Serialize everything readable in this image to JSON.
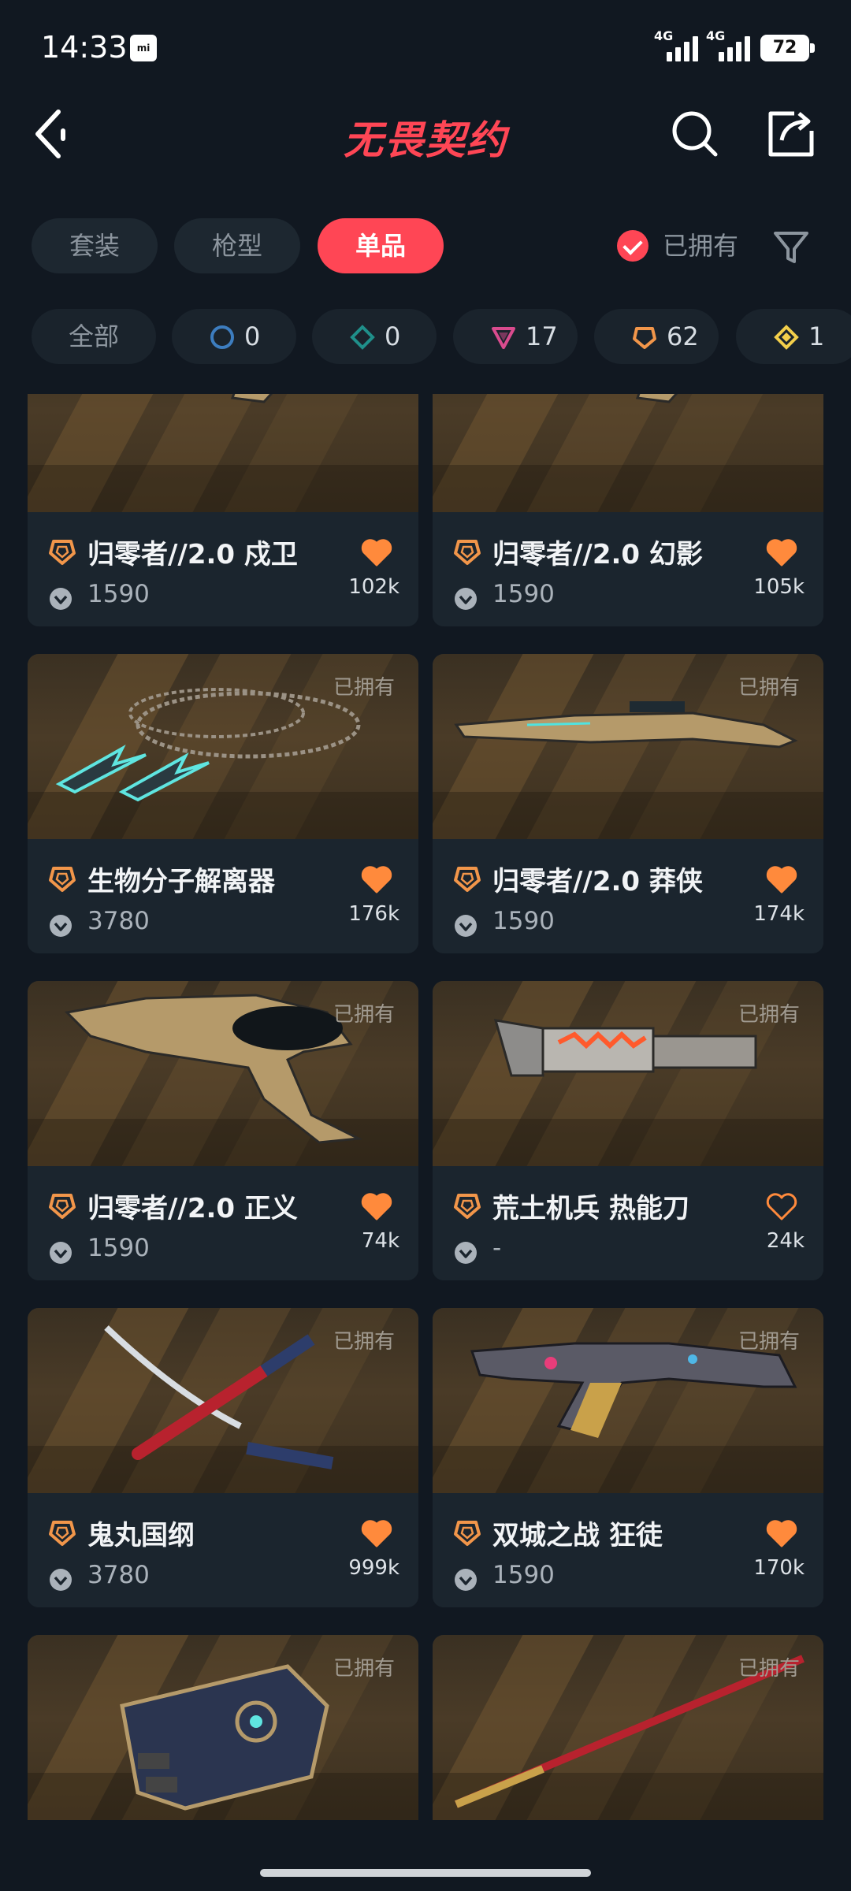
{
  "status_bar": {
    "time": "14:33",
    "mi_badge": "mi",
    "network_1": "4G",
    "network_2": "4G",
    "battery": "72"
  },
  "header": {
    "title": "无畏契约"
  },
  "tabs": [
    {
      "label": "套装",
      "active": false
    },
    {
      "label": "枪型",
      "active": false
    },
    {
      "label": "单品",
      "active": true
    }
  ],
  "owned_filter": {
    "label": "已拥有",
    "checked": true
  },
  "rarity_chips": {
    "all_label": "全部",
    "items": [
      {
        "tier": "select",
        "count": "0",
        "color": "#3d7dbf"
      },
      {
        "tier": "deluxe",
        "count": "0",
        "color": "#1f8f8a"
      },
      {
        "tier": "premium",
        "count": "17",
        "color": "#d94b8e"
      },
      {
        "tier": "exclusive",
        "count": "62",
        "color": "#f2964a"
      },
      {
        "tier": "ultra",
        "count": "1",
        "color": "#f3cf4b"
      }
    ]
  },
  "owned_tag": "已拥有",
  "cards": [
    {
      "name": "归零者//2.0 戍卫",
      "price": "1590",
      "likes": "102k",
      "favorited": true,
      "owned_tag": false,
      "weapon": "rifle-icon"
    },
    {
      "name": "归零者//2.0 幻影",
      "price": "1590",
      "likes": "105k",
      "favorited": true,
      "owned_tag": false,
      "weapon": "rifle-icon"
    },
    {
      "name": "生物分子解离器",
      "price": "3780",
      "likes": "176k",
      "favorited": true,
      "owned_tag": true,
      "weapon": "kunai-icon"
    },
    {
      "name": "归零者//2.0 莽侠",
      "price": "1590",
      "likes": "174k",
      "favorited": true,
      "owned_tag": true,
      "weapon": "sniper-icon"
    },
    {
      "name": "归零者//2.0 正义",
      "price": "1590",
      "likes": "74k",
      "favorited": true,
      "owned_tag": true,
      "weapon": "pistol-icon"
    },
    {
      "name": "荒土机兵 热能刀",
      "price": "-",
      "likes": "24k",
      "favorited": false,
      "owned_tag": true,
      "weapon": "knife-icon"
    },
    {
      "name": "鬼丸国纲",
      "price": "3780",
      "likes": "999k",
      "favorited": true,
      "owned_tag": true,
      "weapon": "katana-icon"
    },
    {
      "name": "双城之战 狂徒",
      "price": "1590",
      "likes": "170k",
      "favorited": true,
      "owned_tag": true,
      "weapon": "ak-icon"
    },
    {
      "name": "",
      "price": "",
      "likes": "",
      "favorited": false,
      "owned_tag": true,
      "weapon": "gauntlet-icon"
    },
    {
      "name": "",
      "price": "",
      "likes": "",
      "favorited": false,
      "owned_tag": true,
      "weapon": "staff-icon"
    }
  ],
  "colors": {
    "accent": "#ff4655",
    "heart": "#ff8a3c",
    "tier_exclusive": "#f2964a",
    "background": "#111821",
    "card": "#1b252e"
  }
}
